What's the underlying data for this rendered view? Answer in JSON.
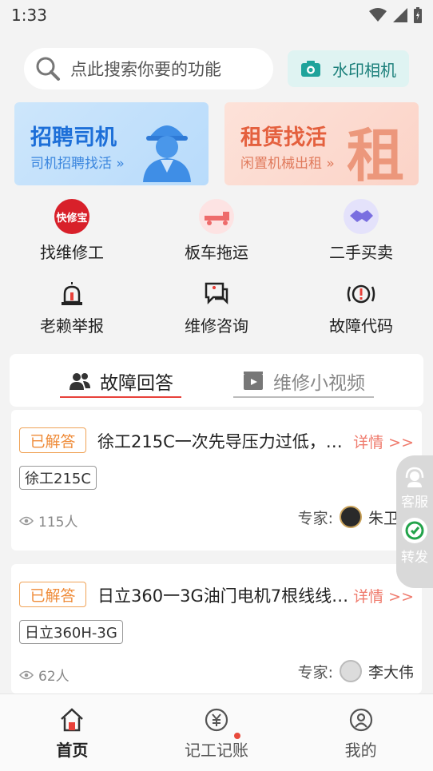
{
  "status_bar": {
    "time": "1:33"
  },
  "search": {
    "placeholder": "点此搜索你要的功能",
    "camera_label": "水印相机"
  },
  "banners": {
    "driver": {
      "title": "招聘司机",
      "subtitle": "司机招聘找活 »"
    },
    "rent": {
      "title": "租赁找活",
      "subtitle": "闲置机械出租 »",
      "big_char": "租"
    }
  },
  "shortcuts": {
    "row1": [
      {
        "label": "找维修工",
        "icon": "kuaixiubao-logo-icon",
        "badge": "快修宝"
      },
      {
        "label": "板车拖运",
        "icon": "flatbed-truck-icon"
      },
      {
        "label": "二手买卖",
        "icon": "handshake-icon"
      }
    ],
    "row2": [
      {
        "label": "老赖举报",
        "icon": "alarm-light-icon"
      },
      {
        "label": "维修咨询",
        "icon": "medical-chat-icon"
      },
      {
        "label": "故障代码",
        "icon": "warning-circle-icon"
      }
    ]
  },
  "tabs": [
    {
      "label": "故障回答",
      "icon": "users-icon",
      "active": true
    },
    {
      "label": "维修小视频",
      "icon": "video-icon",
      "active": false
    }
  ],
  "qa_items": [
    {
      "status": "已解答",
      "title": "徐工215C一次先导压力过低，…",
      "detail": "详情 >>",
      "model": "徐工215C",
      "views": "115人",
      "expert_label": "专家:",
      "expert_name": "朱卫东"
    },
    {
      "status": "已解答",
      "title": "日立360一3G油门电机7根线线…",
      "detail": "详情 >>",
      "model": "日立360H-3G",
      "views": "62人",
      "expert_label": "专家:",
      "expert_name": "李大伟"
    }
  ],
  "float_panel": {
    "service_label": "客服",
    "share_label": "转发"
  },
  "bottom_nav": [
    {
      "label": "首页",
      "icon": "home-icon",
      "active": true
    },
    {
      "label": "记工记账",
      "icon": "yuan-coin-icon",
      "active": false,
      "has_dot": true
    },
    {
      "label": "我的",
      "icon": "user-circle-icon",
      "active": false
    }
  ],
  "colors": {
    "accent": "#e84a3c",
    "teal": "#1a7f7a",
    "badge_orange": "#ef8c3a",
    "detail_red": "#ef7b6d"
  }
}
